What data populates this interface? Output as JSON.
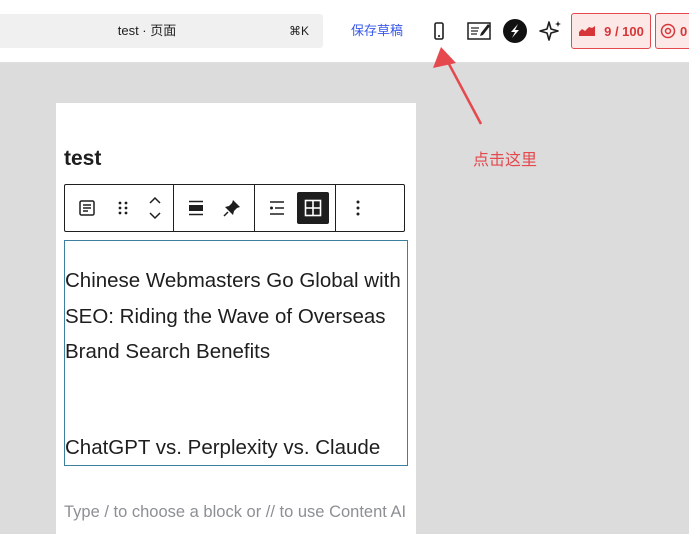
{
  "topbar": {
    "command_title": "test · 页面",
    "command_shortcut": "⌘K",
    "save_draft_label": "保存草稿",
    "seo_score": "9 / 100",
    "at_count": "0"
  },
  "toolbar_icons": [
    "mobile-preview-icon",
    "preview-icon",
    "s-logo-icon",
    "ai-sparkle-icon",
    "seo-score-icon",
    "at-sign-icon"
  ],
  "editor": {
    "page_title": "test",
    "block_toolbar": {
      "icons": [
        "block-type-icon",
        "drag-handle-icon",
        "move-up-icon",
        "move-down-icon",
        "align-wide-icon",
        "pin-icon",
        "list-style-icon",
        "grid-icon",
        "more-options-icon"
      ]
    },
    "content": {
      "paragraph_1": "Chinese Webmasters Go Global with SEO: Riding the Wave of Overseas Brand Search Benefits",
      "paragraph_2": "ChatGPT vs. Perplexity vs. Claude"
    },
    "placeholder": "Type / to choose a block or // to use Content AI"
  },
  "annotation": {
    "text": "点击这里"
  },
  "colors": {
    "accent_blue": "#3858e9",
    "annotation_red": "#e5484d",
    "seo_red": "#d63638",
    "block_outline": "#3c7f9e",
    "canvas_bg": "#dcdcdc"
  }
}
